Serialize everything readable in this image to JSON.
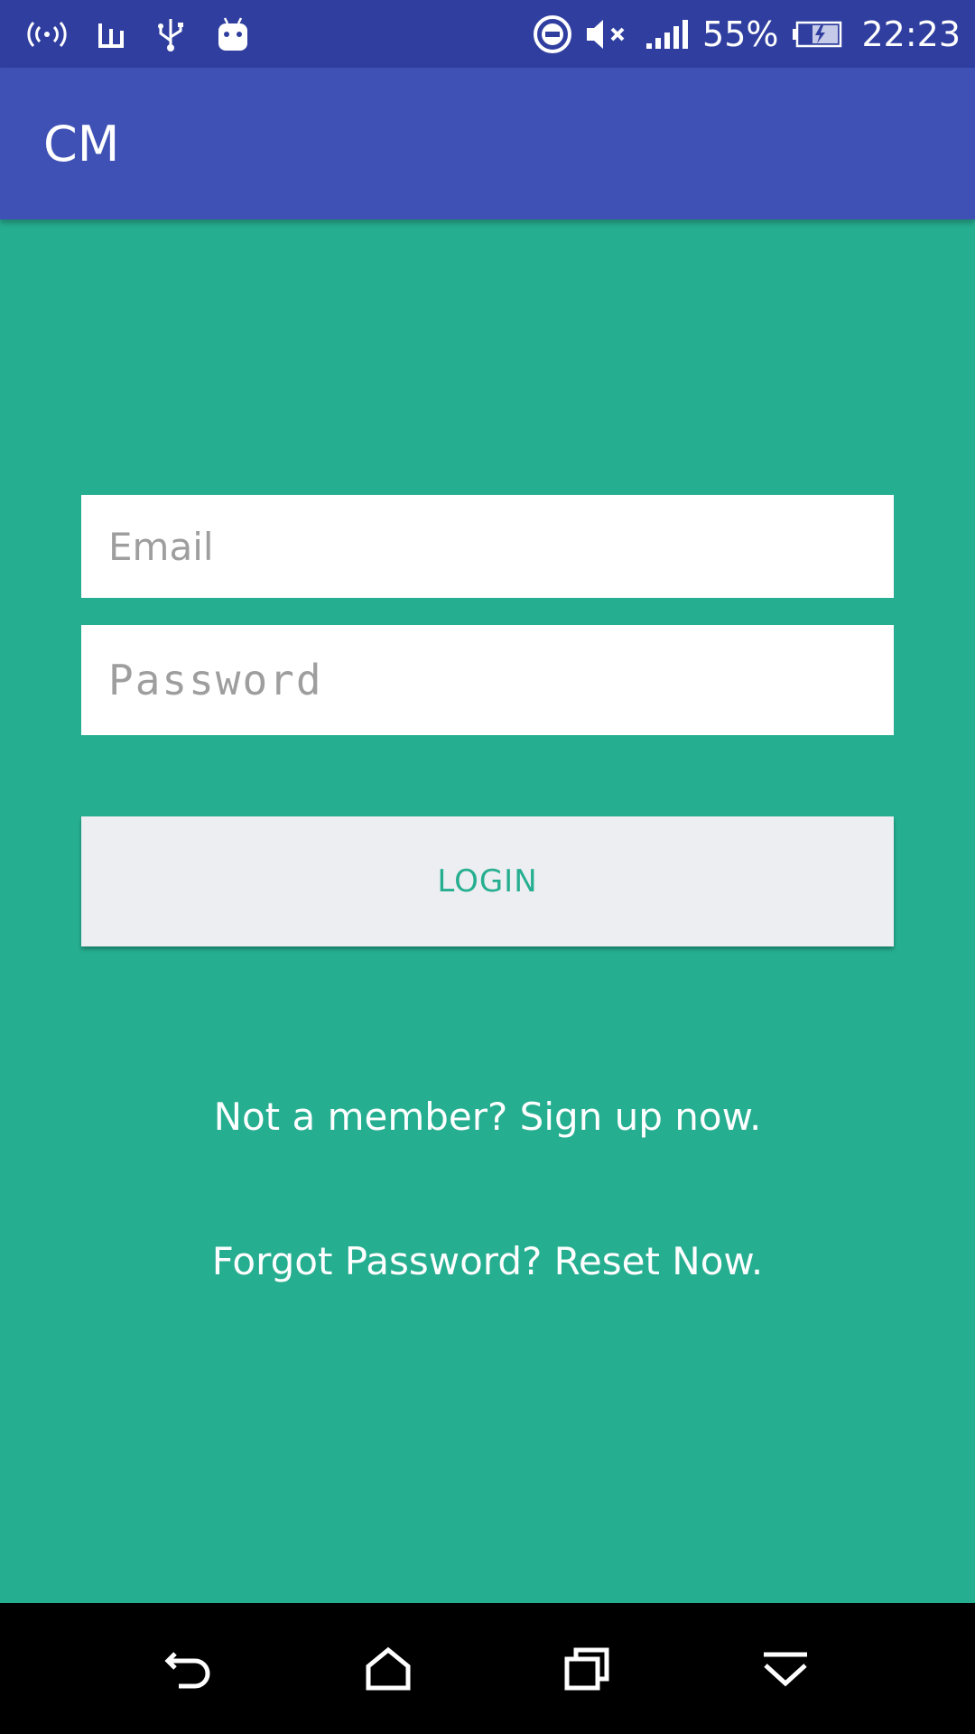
{
  "status_bar": {
    "icons_left": [
      "wifi-hotspot-icon",
      "chart-bars-icon",
      "usb-icon",
      "android-icon"
    ],
    "icons_right": [
      "do-not-disturb-icon",
      "muted-volume-icon",
      "signal-icon",
      "battery-charging-icon"
    ],
    "battery_percent": "55%",
    "time": "22:23"
  },
  "app_bar": {
    "title": "CM",
    "color": "#3f51b5"
  },
  "form": {
    "email_placeholder": "Email",
    "email_value": "",
    "password_placeholder": "Password",
    "password_value": "",
    "login_label": "LOGIN"
  },
  "links": {
    "signup": "Not a member? Sign up now.",
    "reset": "Forgot Password? Reset Now."
  },
  "nav_bar": {
    "icons": [
      "back-icon",
      "home-icon",
      "recents-icon",
      "notifications-down-icon"
    ]
  },
  "colors": {
    "background": "#26ae90",
    "status_bar": "#303f9f",
    "button_bg": "#eceef1",
    "accent_text": "#26ae90"
  }
}
